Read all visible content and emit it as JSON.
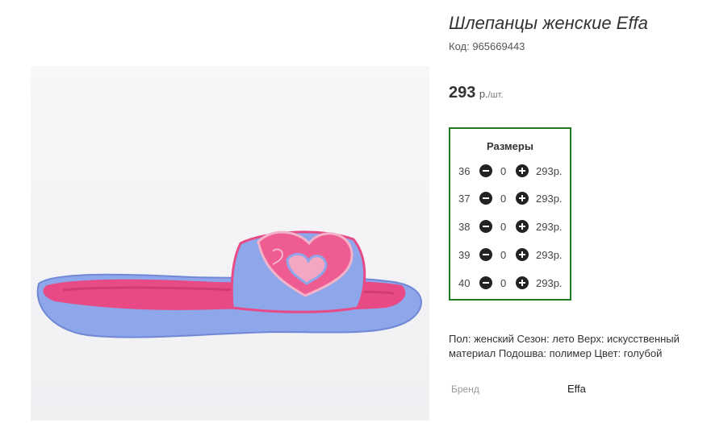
{
  "product": {
    "title": "Шлепанцы женские Effa",
    "code_label": "Код:",
    "code_value": "965669443",
    "price_value": "293",
    "price_currency": "р.",
    "price_unit": "/шт."
  },
  "sizes": {
    "title": "Размеры",
    "rows": [
      {
        "size": "36",
        "qty": "0",
        "price": "293р."
      },
      {
        "size": "37",
        "qty": "0",
        "price": "293р."
      },
      {
        "size": "38",
        "qty": "0",
        "price": "293р."
      },
      {
        "size": "39",
        "qty": "0",
        "price": "293р."
      },
      {
        "size": "40",
        "qty": "0",
        "price": "293р."
      }
    ],
    "border_color": "#1f7a1f"
  },
  "description": "Пол: женский Сезон: лето Верх: искусственный материал Подошва: полимер Цвет: голубой",
  "brand": {
    "label": "Бренд",
    "value": "Effa"
  },
  "colors": {
    "sandal_blue": "#8aa3e8",
    "sandal_pink": "#e8437f"
  }
}
